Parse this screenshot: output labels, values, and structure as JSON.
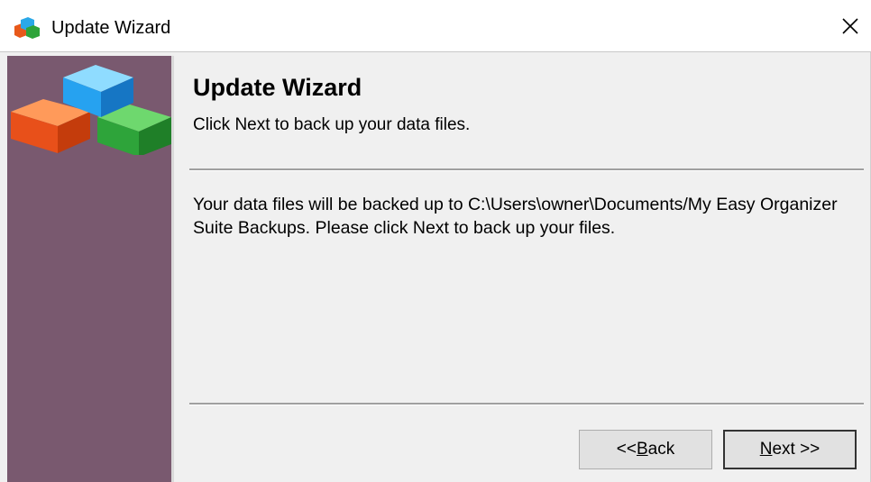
{
  "window": {
    "title": "Update Wizard",
    "app_icon": "blocks-app-icon",
    "close_icon": "close-icon"
  },
  "sidebar": {
    "color": "#79596f",
    "graphic": "colored-blocks-icon"
  },
  "main": {
    "heading": "Update Wizard",
    "subheading": "Click Next to back up your data files.",
    "body": "Your data files will be backed up to C:\\Users\\owner\\Documents/My Easy Organizer Suite Backups.  Please click Next to back up your files."
  },
  "buttons": {
    "back_prefix": "<< ",
    "back_mnemonic": "B",
    "back_rest": "ack",
    "next_mnemonic": "N",
    "next_rest": "ext >>"
  }
}
